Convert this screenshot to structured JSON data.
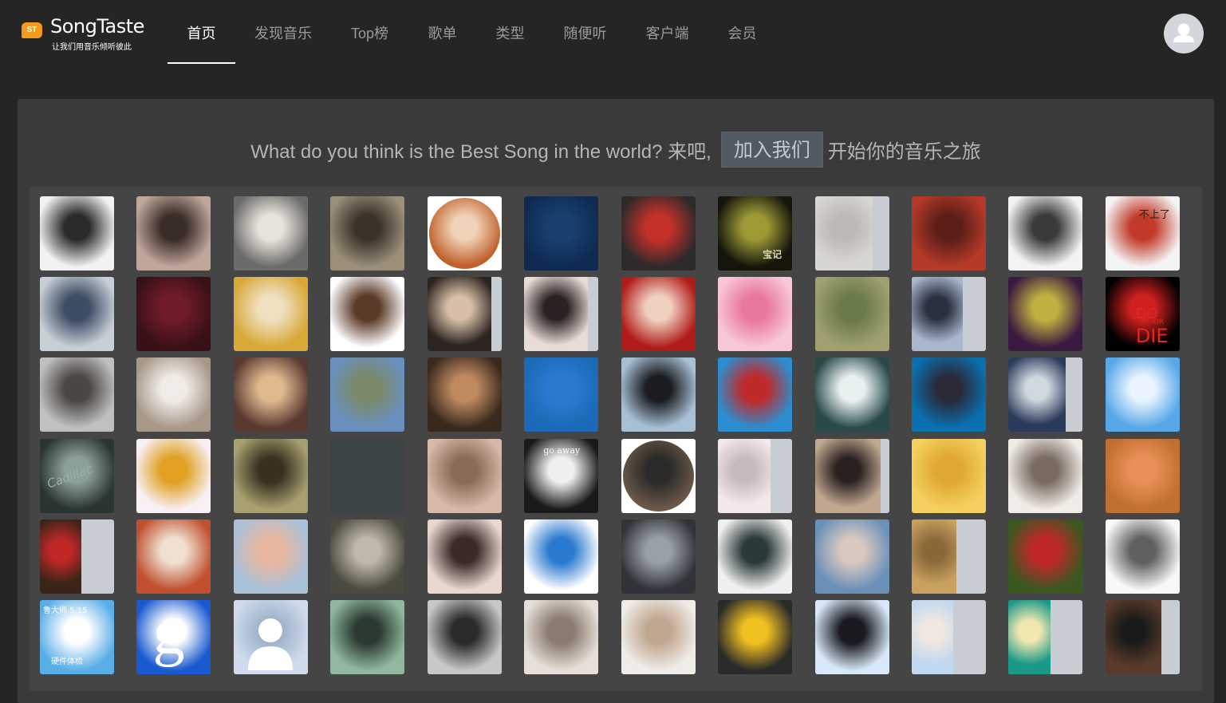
{
  "brand": {
    "badge": "ST",
    "name": "SongTaste",
    "slogan": "让我们用音乐倾听彼此"
  },
  "nav": {
    "items": [
      {
        "label": "首页",
        "active": true
      },
      {
        "label": "发现音乐",
        "active": false
      },
      {
        "label": "Top榜",
        "active": false
      },
      {
        "label": "歌单",
        "active": false
      },
      {
        "label": "类型",
        "active": false
      },
      {
        "label": "随便听",
        "active": false
      },
      {
        "label": "客户端",
        "active": false
      },
      {
        "label": "会员",
        "active": false
      }
    ]
  },
  "user": {
    "avatar_icon": "user-icon"
  },
  "hero": {
    "question": "What do you think is the Best Song in the world? 来吧,",
    "join_label": "加入我们",
    "tagline": "开始你的音乐之旅"
  },
  "avatars": {
    "tile_texts": {
      "r0c7": "宝记",
      "r0c11": "不上了",
      "r1c11_a": "DO",
      "r1c11_b": "OR",
      "r1c11_c": "DIE",
      "r3c0": "Cadillac",
      "r3c5": "go away",
      "r5c0_a": "鲁大师 5.15",
      "r5c0_b": "硬件体检",
      "r5c1": "g"
    },
    "rows": [
      [
        [
          "#f2f2f2",
          "#2a2a2a"
        ],
        [
          "#bfa79a",
          "#3a2c28"
        ],
        [
          "#6c6b6a",
          "#e8e4dc"
        ],
        [
          "#9b8f7a",
          "#3b3328"
        ],
        [
          "#c0602a",
          "#f0d3b8"
        ],
        [
          "#0e2a52",
          "#18406e"
        ],
        [
          "#2d2a2b",
          "#c6302a"
        ],
        [
          "#15150c",
          "#9d9a36"
        ],
        [
          "#d8d6d3",
          "#bcb9b4"
        ],
        [
          "#b53a2a",
          "#5c1e18"
        ],
        [
          "#f3f3f3",
          "#3a3a3a"
        ],
        [
          "#f4f4f4",
          "#c23a2a"
        ]
      ],
      [
        [
          "#c8ced6",
          "#3c4e64"
        ],
        [
          "#3a1018",
          "#701c28"
        ],
        [
          "#d8a838",
          "#f0e0c0"
        ],
        [
          "#ffffff",
          "#5a3a28"
        ],
        [
          "#2c2420",
          "#d8c0a8"
        ],
        [
          "#e9dbd6",
          "#2a2222"
        ],
        [
          "#b01c18",
          "#f0d0c0"
        ],
        [
          "#f8c8d8",
          "#e8789c"
        ],
        [
          "#a0a070",
          "#6a7a48"
        ],
        [
          "#a8b8cc",
          "#2a3040"
        ],
        [
          "#3a1a40",
          "#c0b040"
        ],
        [
          "#000000",
          "#d02020"
        ]
      ],
      [
        [
          "#c0c0c2",
          "#4a4642"
        ],
        [
          "#a89888",
          "#f0ece8"
        ],
        [
          "#5a3a30",
          "#e0b890"
        ],
        [
          "#6a90c0",
          "#7a8a6a"
        ],
        [
          "#3a2a1e",
          "#c08a60"
        ],
        [
          "#1a6ab8",
          "#2a7ad0"
        ],
        [
          "#a8c0d4",
          "#1a1c20"
        ],
        [
          "#2c8ed0",
          "#c02a2a"
        ],
        [
          "#2a4a4a",
          "#e8f0f0"
        ],
        [
          "#0a70b0",
          "#2a2a38"
        ],
        [
          "#2a3a5a",
          "#d0d8e0"
        ],
        [
          "#58a8e8",
          "#e8f4ff"
        ]
      ],
      [
        [
          "#2a3430",
          "#8aa09a"
        ],
        [
          "#f8f0f4",
          "#e0a020"
        ],
        [
          "#a8a070",
          "#3a3020"
        ],
        [
          "#3c4445",
          "#3c4445"
        ],
        [
          "#d8b8a8",
          "#8a6a58"
        ],
        [
          "#1a1a1a",
          "#f0f0f0"
        ],
        [
          "#6a5848",
          "#2a2a28"
        ],
        [
          "#f4e8ec",
          "#c8b8c0"
        ],
        [
          "#c0a890",
          "#2a2020"
        ],
        [
          "#f4d060",
          "#e0a830"
        ],
        [
          "#f0ece8",
          "#7a6a60"
        ],
        [
          "#c07030",
          "#e89058"
        ]
      ],
      [
        [
          "#3a2418",
          "#c02828"
        ],
        [
          "#c05030",
          "#f0e0d0"
        ],
        [
          "#a8c0d8",
          "#e8b8a0"
        ],
        [
          "#4a4a40",
          "#c0b8a8"
        ],
        [
          "#e8d8d0",
          "#3a2a28"
        ],
        [
          "#ffffff",
          "#2a7ad0"
        ],
        [
          "#303438",
          "#9aa0a8"
        ],
        [
          "#f0f0ee",
          "#2a3a3a"
        ],
        [
          "#6a90b8",
          "#d8c8c0"
        ],
        [
          "#c8a060",
          "#8a6838"
        ],
        [
          "#3a5820",
          "#c02828"
        ],
        [
          "#f8f8f8",
          "#606060"
        ]
      ],
      [
        [
          "#5aaee8",
          "#ffffff"
        ],
        [
          "#1a5ad0",
          "#ffffff"
        ],
        [
          "#cfdceb",
          "#a0b4cc"
        ],
        [
          "#90b8a0",
          "#2a3a30"
        ],
        [
          "#c8c8c8",
          "#2a2a2a"
        ],
        [
          "#e8e0d8",
          "#8a7a70"
        ],
        [
          "#f0ece8",
          "#c0a890"
        ],
        [
          "#2a2a2a",
          "#f0c020"
        ],
        [
          "#d8e8f8",
          "#1a1a20"
        ],
        [
          "#c0d8f0",
          "#f0e8e0"
        ],
        [
          "#1a9888",
          "#f0e8b0"
        ],
        [
          "#5a3a2a",
          "#1a1a1a"
        ]
      ]
    ]
  }
}
